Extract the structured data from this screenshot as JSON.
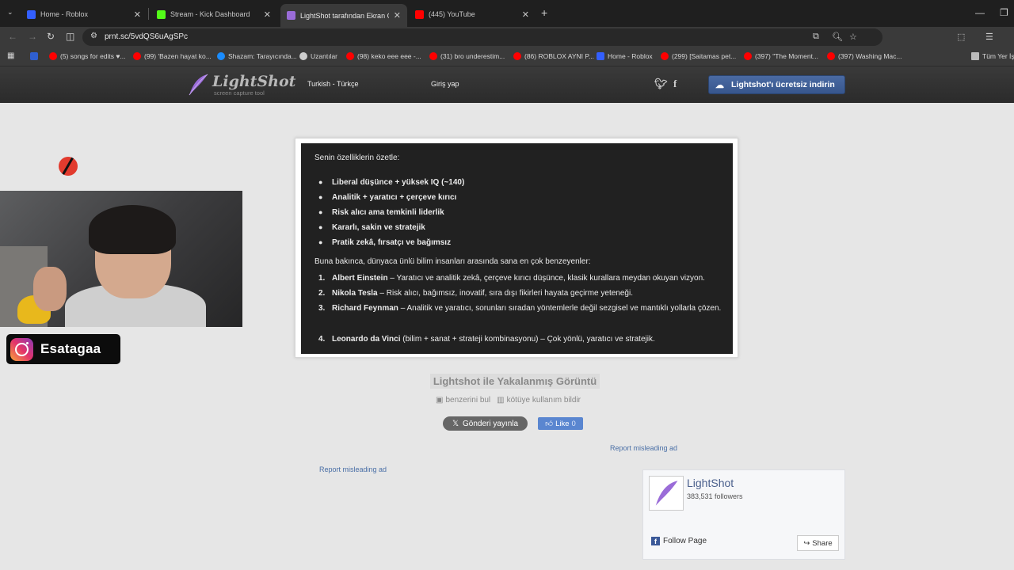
{
  "browser": {
    "tabs": [
      {
        "title": "Home - Roblox",
        "color": "#335fff",
        "active": false
      },
      {
        "title": "Stream - Kick Dashboard",
        "color": "#53fc18",
        "active": false
      },
      {
        "title": "LightShot tarafından Ekran Gör...",
        "color": "#9a6cd8",
        "active": true
      },
      {
        "title": "(445) YouTube",
        "color": "#ff0000",
        "active": false
      }
    ],
    "new_tab": "+",
    "url": "prnt.sc/5vdQS6uAgSPc",
    "bookmarks": [
      {
        "label": "(5) songs for edits ♥...",
        "color": "#ff0000"
      },
      {
        "label": "(99) 'Bazen hayat ko...",
        "color": "#ff0000"
      },
      {
        "label": "Shazam: Tarayıcında...",
        "color": "#1a8cff"
      },
      {
        "label": "Uzantılar",
        "color": "#cccccc"
      },
      {
        "label": "(98) keko eee eee -...",
        "color": "#ff0000"
      },
      {
        "label": "(31) bro underestim...",
        "color": "#ff0000"
      },
      {
        "label": "(86) ROBLOX AYNI P...",
        "color": "#ff0000"
      },
      {
        "label": "Home - Roblox",
        "color": "#335fff"
      },
      {
        "label": "(299) [Saitamas pet...",
        "color": "#ff0000"
      },
      {
        "label": "(397) \"The Moment...",
        "color": "#ff0000"
      },
      {
        "label": "(397) Washing Mac...",
        "color": "#ff0000"
      }
    ],
    "bookmarks_all": "Tüm Yer İş"
  },
  "lightshot": {
    "logo": "LightShot",
    "logo_sub": "screen capture tool",
    "language": "Turkish - Türkçe",
    "login": "Giriş yap",
    "download": "Lightshot'ı ücretsiz indirin",
    "caption": "Lightshot ile Yakalanmış Görüntü",
    "similar": "benzerini bul",
    "report_abuse": "kötüye kullanım bildir",
    "tweet": "Gönderi yayınla",
    "like": "Like",
    "like_count": "0",
    "report_ad": "Report misleading ad",
    "fb_page": {
      "name": "LightShot",
      "followers": "383,531 followers",
      "follow": "Follow Page",
      "share": "Share"
    }
  },
  "screenshot": {
    "heading": "Senin özelliklerin özetle:",
    "traits": [
      "Liberal düşünce + yüksek IQ (~140)",
      "Analitik + yaratıcı + çerçeve kırıcı",
      "Risk alıcı ama temkinli liderlik",
      "Kararlı, sakin ve stratejik",
      "Pratik zekâ, fırsatçı ve bağımsız"
    ],
    "intro": "Buna bakınca, dünyaca ünlü bilim insanları arasında sana en çok benzeyenler:",
    "people": [
      {
        "num": "1.",
        "name": "Albert Einstein",
        "desc": " – Yaratıcı ve analitik zekâ, çerçeve kırıcı düşünce, klasik kurallara meydan okuyan vizyon."
      },
      {
        "num": "2.",
        "name": "Nikola Tesla",
        "desc": " – Risk alıcı, bağımsız, inovatif, sıra dışı fikirleri hayata geçirme yeteneği."
      },
      {
        "num": "3.",
        "name": "Richard Feynman",
        "desc": " – Analitik ve yaratıcı, sorunları sıradan yöntemlerle değil sezgisel ve mantıklı yollarla çözen."
      },
      {
        "num": "4.",
        "name": "Leonardo da Vinci",
        "desc": " (bilim + sanat + strateji kombinasyonu) – Çok yönlü, yaratıcı ve stratejik."
      }
    ]
  },
  "stream": {
    "instagram_handle": "Esatagaa"
  }
}
